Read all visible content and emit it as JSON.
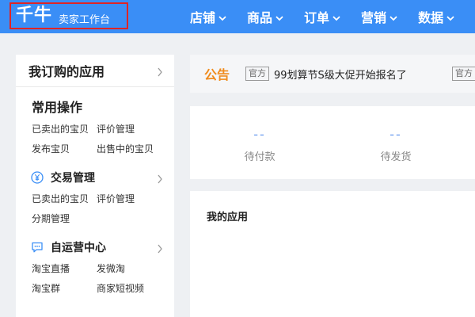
{
  "header": {
    "brand_logo": "千牛",
    "brand_sub": "卖家工作台",
    "nav": [
      {
        "label": "店铺"
      },
      {
        "label": "商品"
      },
      {
        "label": "订单"
      },
      {
        "label": "营销"
      },
      {
        "label": "数据"
      }
    ]
  },
  "sidebar": {
    "title": "我订购的应用",
    "common": {
      "title": "常用操作",
      "rows": [
        [
          "已卖出的宝贝",
          "评价管理"
        ],
        [
          "发布宝贝",
          "出售中的宝贝"
        ]
      ]
    },
    "groups": [
      {
        "title": "交易管理",
        "icon": "yen-circle-icon",
        "rows": [
          [
            "已卖出的宝贝",
            "评价管理"
          ],
          [
            "分期管理"
          ]
        ]
      },
      {
        "title": "自运营中心",
        "icon": "chat-bubble-icon",
        "rows": [
          [
            "淘宝直播",
            "发微淘"
          ],
          [
            "淘宝群",
            "商家短视频"
          ]
        ]
      }
    ]
  },
  "notice": {
    "title": "公告",
    "tag": "官方",
    "text": "99划算节S级大促开始报名了",
    "tag2": "官方"
  },
  "stats": [
    {
      "value": "--",
      "label": "待付款"
    },
    {
      "value": "--",
      "label": "待发货"
    }
  ],
  "apps": {
    "title": "我的应用"
  },
  "colors": {
    "header_bg": "#3a8ef6",
    "notice_accent": "#f08c1e",
    "highlight_border": "#e02424"
  }
}
